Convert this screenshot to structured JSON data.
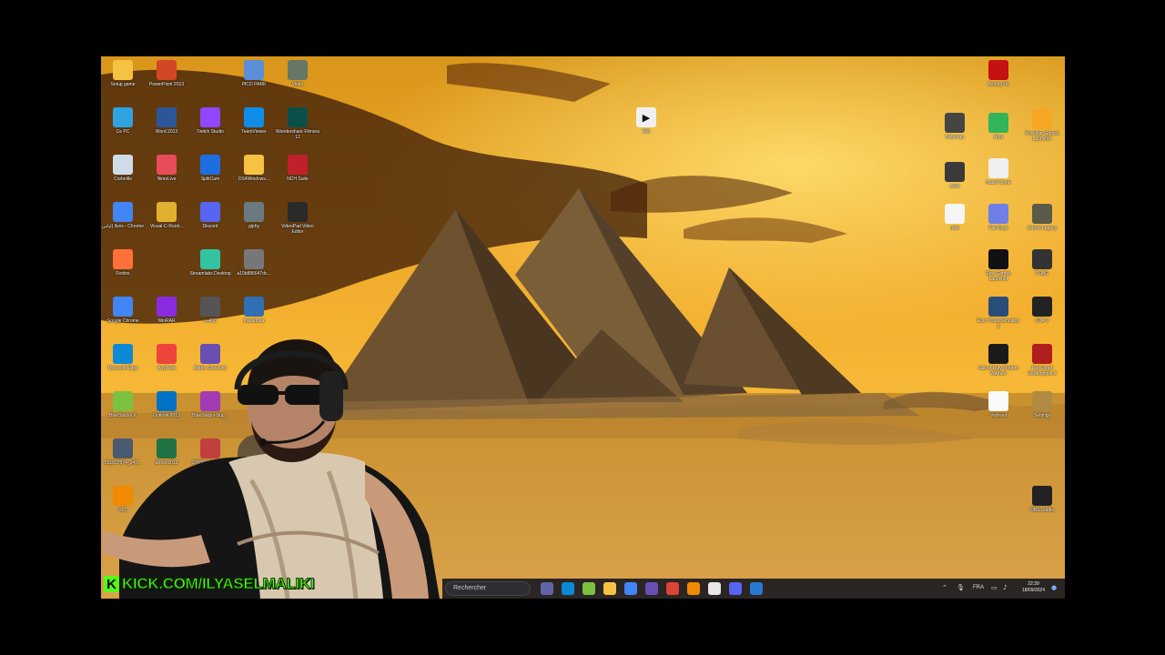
{
  "desktop": {
    "left_icons": [
      {
        "label": "Setup game",
        "icon": "folder-icon",
        "color": "#f5c242"
      },
      {
        "label": "PowerPoint 2013",
        "icon": "powerpoint-icon",
        "color": "#d24726"
      },
      {
        "label": "PICO PARK",
        "icon": "pico-park-icon",
        "color": "#5b8fd9"
      },
      {
        "label": "Vidéo",
        "icon": "video-file-icon",
        "color": "#667766"
      },
      {
        "label": "Ce PC",
        "icon": "computer-icon",
        "color": "#2fa3e0"
      },
      {
        "label": "Word 2013",
        "icon": "word-icon",
        "color": "#2b579a"
      },
      {
        "label": "Twitch Studio",
        "icon": "twitch-icon",
        "color": "#9146ff"
      },
      {
        "label": "TeamViewer",
        "icon": "teamviewer-icon",
        "color": "#0e8ee9"
      },
      {
        "label": "Wondershare Filmora 12",
        "icon": "filmora-icon",
        "color": "#0a4f4a"
      },
      {
        "label": "Corbeille",
        "icon": "recycle-bin-icon",
        "color": "#cfdbe8"
      },
      {
        "label": "NimoLive",
        "icon": "nimolive-icon",
        "color": "#e84c5b"
      },
      {
        "label": "SplitCam",
        "icon": "splitcam-icon",
        "color": "#1d6fe0"
      },
      {
        "label": "DS4Windows...",
        "icon": "folder-icon",
        "color": "#f5c242"
      },
      {
        "label": "NCH Suite",
        "icon": "nch-suite-icon",
        "color": "#c0202a"
      },
      {
        "label": "إلياس Ilyes - Chrome",
        "icon": "chrome-icon",
        "color": "#4285f4"
      },
      {
        "label": "Visual-C-Runti...",
        "icon": "folder-icon",
        "color": "#e0b030"
      },
      {
        "label": "Discord",
        "icon": "discord-icon",
        "color": "#5865f2"
      },
      {
        "label": "giphy",
        "icon": "image-file-icon",
        "color": "#6b7a80"
      },
      {
        "label": "VideoPad Video Editor",
        "icon": "videopad-icon",
        "color": "#2a2a2a"
      },
      {
        "label": "Firefox",
        "icon": "firefox-icon",
        "color": "#ff7139"
      },
      {
        "label": "Streamlabs Desktop",
        "icon": "streamlabs-icon",
        "color": "#31c3a2"
      },
      {
        "label": "a10b886647dc...",
        "icon": "image-file-icon",
        "color": "#777777"
      },
      {
        "label": "Google Chrome",
        "icon": "chrome-icon",
        "color": "#4285f4"
      },
      {
        "label": "WinRAR",
        "icon": "winrar-icon",
        "color": "#8a2be2"
      },
      {
        "label": "s-i400",
        "icon": "keyboard-icon",
        "color": "#555555"
      },
      {
        "label": "maradona",
        "icon": "image-file-icon",
        "color": "#2f6fb2"
      },
      {
        "label": "Microsoft Edge",
        "icon": "edge-icon",
        "color": "#0c8ad6"
      },
      {
        "label": "AnyDesk",
        "icon": "anydesk-icon",
        "color": "#ef443b"
      },
      {
        "label": "Better-CrewLink",
        "icon": "crewlink-icon",
        "color": "#6a4fb3"
      },
      {
        "label": "BlueStacks X",
        "icon": "bluestacks-icon",
        "color": "#7cc242"
      },
      {
        "label": "Outlook 2013",
        "icon": "outlook-icon",
        "color": "#0072c6"
      },
      {
        "label": "BlueStacks-Sup...",
        "icon": "winrar-icon",
        "color": "#a23bb5"
      },
      {
        "label": "531037574_347...",
        "icon": "image-file-icon",
        "color": "#4a5a70"
      },
      {
        "label": "Excel 2013",
        "icon": "excel-icon",
        "color": "#217346"
      },
      {
        "label": "376866120_940...",
        "icon": "image-file-icon",
        "color": "#c04040"
      },
      {
        "label": "VLC",
        "icon": "vlc-icon",
        "color": "#f08a00"
      }
    ],
    "center_icon": {
      "label": "Kiki",
      "icon": "media-file-icon",
      "color": "#f0f0f0"
    },
    "right_icons": [
      {
        "label": "Among Us",
        "icon": "among-us-icon",
        "color": "#c51111"
      },
      {
        "label": "Rockstar Games Launcher",
        "icon": "rockstar-icon",
        "color": "#f5a623"
      },
      {
        "label": "Nouveau",
        "icon": "monitor-icon",
        "color": "#444444"
      },
      {
        "label": "Arca",
        "icon": "arca-icon",
        "color": "#33b35a"
      },
      {
        "label": "Hazel Clone",
        "icon": "cloud-icon",
        "color": "#f0f0f0"
      },
      {
        "label": "www",
        "icon": "monitor-icon",
        "color": "#3a3a3a"
      },
      {
        "label": "Fall Guys",
        "icon": "fall-guys-icon",
        "color": "#6f7fe8"
      },
      {
        "label": "Unreal Legacy",
        "icon": "game-icon",
        "color": "#5a5a4a"
      },
      {
        "label": "note",
        "icon": "document-icon",
        "color": "#f5f5f5"
      },
      {
        "label": "Epic Games Launcher",
        "icon": "epic-games-icon",
        "color": "#111111"
      },
      {
        "label": "PUBG",
        "icon": "pubg-icon",
        "color": "#333333"
      },
      {
        "label": "Euro Truck Simulator 2",
        "icon": "truck-icon",
        "color": "#2a4e7a"
      },
      {
        "label": "GTA V",
        "icon": "gta-icon",
        "color": "#222222"
      },
      {
        "label": "Call of Duty Modern Warfare",
        "icon": "mw-wz-icon",
        "color": "#1a1a1a"
      },
      {
        "label": "Red Dead Redemption 2",
        "icon": "rdr2-icon",
        "color": "#b01e1e"
      },
      {
        "label": "Valorant",
        "icon": "valorant-icon",
        "color": "#fafafa"
      },
      {
        "label": "Settings",
        "icon": "gear-icon",
        "color": "#b08a40"
      },
      {
        "label": "OBS Studio",
        "icon": "obs-icon",
        "color": "#222222"
      }
    ]
  },
  "taskbar": {
    "search_placeholder": "Rechercher",
    "apps": [
      {
        "icon": "teams-icon",
        "color": "#6264a7"
      },
      {
        "icon": "edge-icon",
        "color": "#0c8ad6"
      },
      {
        "icon": "bluestacks-icon",
        "color": "#7cc242"
      },
      {
        "icon": "file-explorer-icon",
        "color": "#f5c242"
      },
      {
        "icon": "chrome-icon",
        "color": "#4285f4"
      },
      {
        "icon": "crewlink-icon",
        "color": "#6a4fb3"
      },
      {
        "icon": "chrome-icon",
        "color": "#db4437"
      },
      {
        "icon": "vlc-icon",
        "color": "#f08a00"
      },
      {
        "icon": "store-icon",
        "color": "#e8e8e8"
      },
      {
        "icon": "discord-icon",
        "color": "#5865f2"
      },
      {
        "icon": "shield-icon",
        "color": "#2a78d2"
      }
    ],
    "language": "FRA",
    "time": "22:39",
    "date": "18/09/2024"
  },
  "stream": {
    "watermark_url": "KICK.COM/ILYASELMALIKI",
    "watermark_logo": "K"
  }
}
